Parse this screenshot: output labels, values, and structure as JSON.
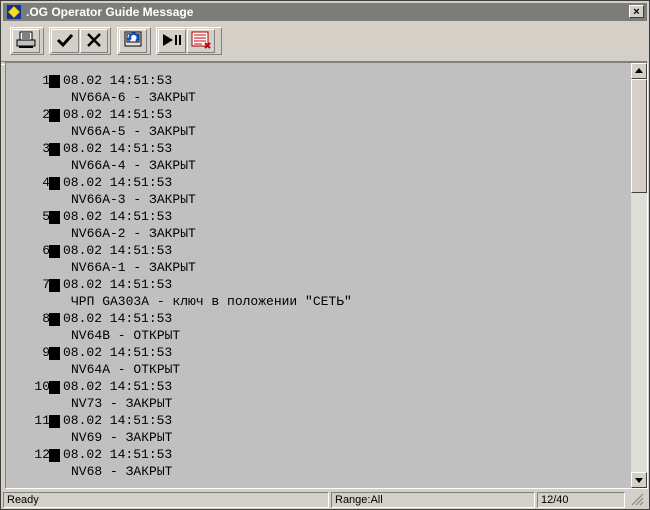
{
  "window": {
    "title": ".OG Operator Guide Message",
    "close_label": "×"
  },
  "toolbar": {
    "buttons": [
      "print-icon",
      "check-icon",
      "cross-icon",
      "reload-icon",
      "play-pause-icon",
      "list-close-icon"
    ]
  },
  "messages": [
    {
      "num": "1",
      "time": "08.02 14:51:53",
      "text": "NV66A-6 - ЗАКРЫТ"
    },
    {
      "num": "2",
      "time": "08.02 14:51:53",
      "text": "NV66A-5 - ЗАКРЫТ"
    },
    {
      "num": "3",
      "time": "08.02 14:51:53",
      "text": "NV66A-4 - ЗАКРЫТ"
    },
    {
      "num": "4",
      "time": "08.02 14:51:53",
      "text": "NV66A-3 - ЗАКРЫТ"
    },
    {
      "num": "5",
      "time": "08.02 14:51:53",
      "text": "NV66A-2 - ЗАКРЫТ"
    },
    {
      "num": "6",
      "time": "08.02 14:51:53",
      "text": "NV66A-1 - ЗАКРЫТ"
    },
    {
      "num": "7",
      "time": "08.02 14:51:53",
      "text": "ЧРП GA303A - ключ в положении \"СЕТЬ\""
    },
    {
      "num": "8",
      "time": "08.02 14:51:53",
      "text": "NV64B - ОТКРЫТ"
    },
    {
      "num": "9",
      "time": "08.02 14:51:53",
      "text": "NV64A - ОТКРЫТ"
    },
    {
      "num": "10",
      "time": "08.02 14:51:53",
      "text": "NV73 - ЗАКРЫТ"
    },
    {
      "num": "11",
      "time": "08.02 14:51:53",
      "text": "NV69 - ЗАКРЫТ"
    },
    {
      "num": "12",
      "time": "08.02 14:51:53",
      "text": "NV68 - ЗАКРЫТ"
    }
  ],
  "status": {
    "state": "Ready",
    "range": "Range:All",
    "position": "12/40"
  }
}
